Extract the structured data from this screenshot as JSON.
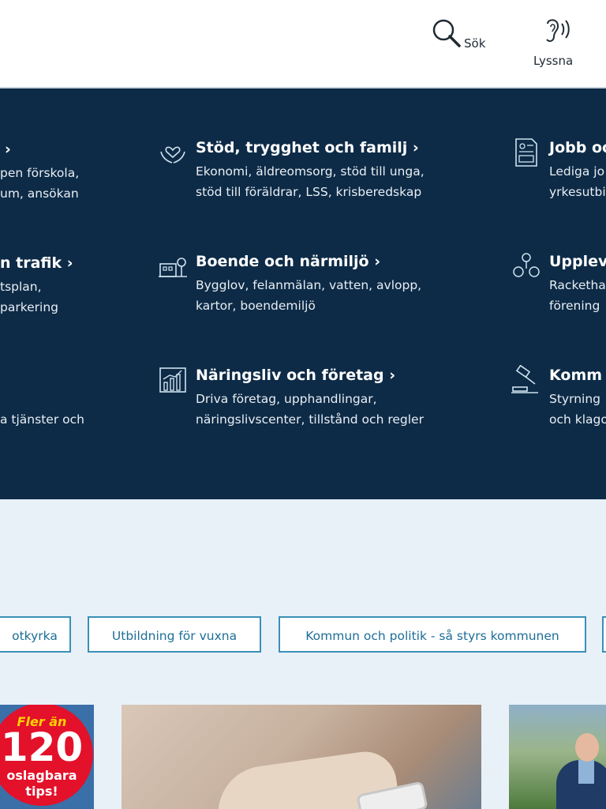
{
  "header": {
    "search_label": "Sök",
    "listen_label": "Lyssna",
    "icons": {
      "search": "search-icon",
      "listen": "ear-icon"
    }
  },
  "nav": {
    "partial_left": {
      "row1_title": "›",
      "row1_desc": [
        "pen förskola,",
        "um, ansökan"
      ],
      "row2_title": "n trafik ›",
      "row2_desc": [
        "tsplan,",
        "parkering"
      ],
      "row3_desc": "a tjänster och"
    },
    "items": [
      {
        "title": "Stöd, trygghet och familj ›",
        "desc": [
          "Ekonomi, äldreomsorg, stöd till unga,",
          "stöd till föräldrar, LSS, krisberedskap"
        ],
        "icon": "heart-hands-icon"
      },
      {
        "title": "Jobb oc",
        "desc": [
          "Lediga jo",
          "yrkesutbi"
        ],
        "icon": "cv-document-icon"
      },
      {
        "title": "Boende och närmiljö ›",
        "desc": [
          "Bygglov, felanmälan, vatten, avlopp,",
          "kartor, boendemiljö"
        ],
        "icon": "house-tree-icon"
      },
      {
        "title": "Upplev",
        "desc": [
          "Racketha",
          "förening"
        ],
        "icon": "activities-icon"
      },
      {
        "title": "Näringsliv och företag ›",
        "desc": [
          "Driva företag, upphandlingar,",
          "näringslivscenter, tillstånd och regler"
        ],
        "icon": "bar-chart-icon"
      },
      {
        "title": "Komm",
        "desc": [
          "Styrning",
          "och klago"
        ],
        "icon": "gavel-icon"
      }
    ]
  },
  "quick_links": [
    "otkyrka",
    "Utbildning för vuxna",
    "Kommun och politik - så styrs kommunen"
  ],
  "cards": {
    "badge": {
      "top": "Fler än",
      "number": "120",
      "bottom1": "oslagbara",
      "bottom2": "tips!"
    }
  },
  "colors": {
    "nav_bg": "#0d2b47",
    "page_bg": "#e8f1f8",
    "link_border": "#3a8fb7",
    "link_text": "#1c6e97",
    "badge_red": "#e3112a"
  }
}
